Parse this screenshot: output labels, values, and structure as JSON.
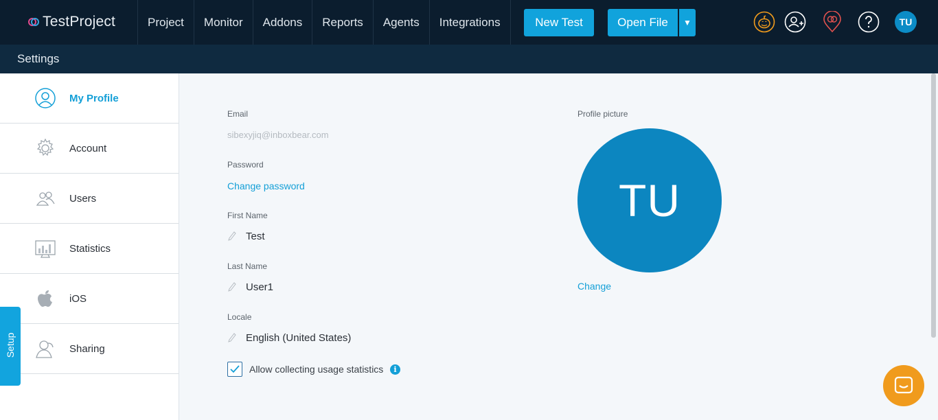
{
  "app": {
    "logo_text": "TestProject"
  },
  "nav": [
    {
      "label": "Project"
    },
    {
      "label": "Monitor"
    },
    {
      "label": "Addons"
    },
    {
      "label": "Reports"
    },
    {
      "label": "Agents"
    },
    {
      "label": "Integrations"
    }
  ],
  "toolbar": {
    "new_test_label": "New Test",
    "open_file_label": "Open File",
    "caret_icon": "caret-down-icon",
    "icons": [
      "pumpkin-icon",
      "add-user-icon",
      "location-pin-icon",
      "help-icon"
    ],
    "avatar_initials": "TU"
  },
  "subheader": {
    "title": "Settings"
  },
  "sidebar": {
    "items": [
      {
        "label": "My Profile",
        "icon": "user-circle-icon",
        "active": true
      },
      {
        "label": "Account",
        "icon": "gear-icon",
        "active": false
      },
      {
        "label": "Users",
        "icon": "users-icon",
        "active": false
      },
      {
        "label": "Statistics",
        "icon": "bar-chart-icon",
        "active": false
      },
      {
        "label": "iOS",
        "icon": "apple-icon",
        "active": false
      },
      {
        "label": "Sharing",
        "icon": "sharing-icon",
        "active": false
      }
    ],
    "setup_label": "Setup"
  },
  "profile": {
    "email_label": "Email",
    "email_value": "sibexyjiq@inboxbear.com",
    "password_label": "Password",
    "change_password_link": "Change password",
    "first_name_label": "First Name",
    "first_name_value": "Test",
    "last_name_label": "Last Name",
    "last_name_value": "User1",
    "locale_label": "Locale",
    "locale_value": "English (United States)",
    "stats_checkbox_label": "Allow collecting usage statistics",
    "stats_checked": true,
    "info_icon": "i",
    "picture_label": "Profile picture",
    "picture_initials": "TU",
    "change_picture_link": "Change"
  },
  "colors": {
    "accent": "#139fd7",
    "topbar": "#0b1d2e",
    "subbar": "#0f2a40",
    "avatar": "#0c86c0",
    "chat": "#f09b1d"
  }
}
